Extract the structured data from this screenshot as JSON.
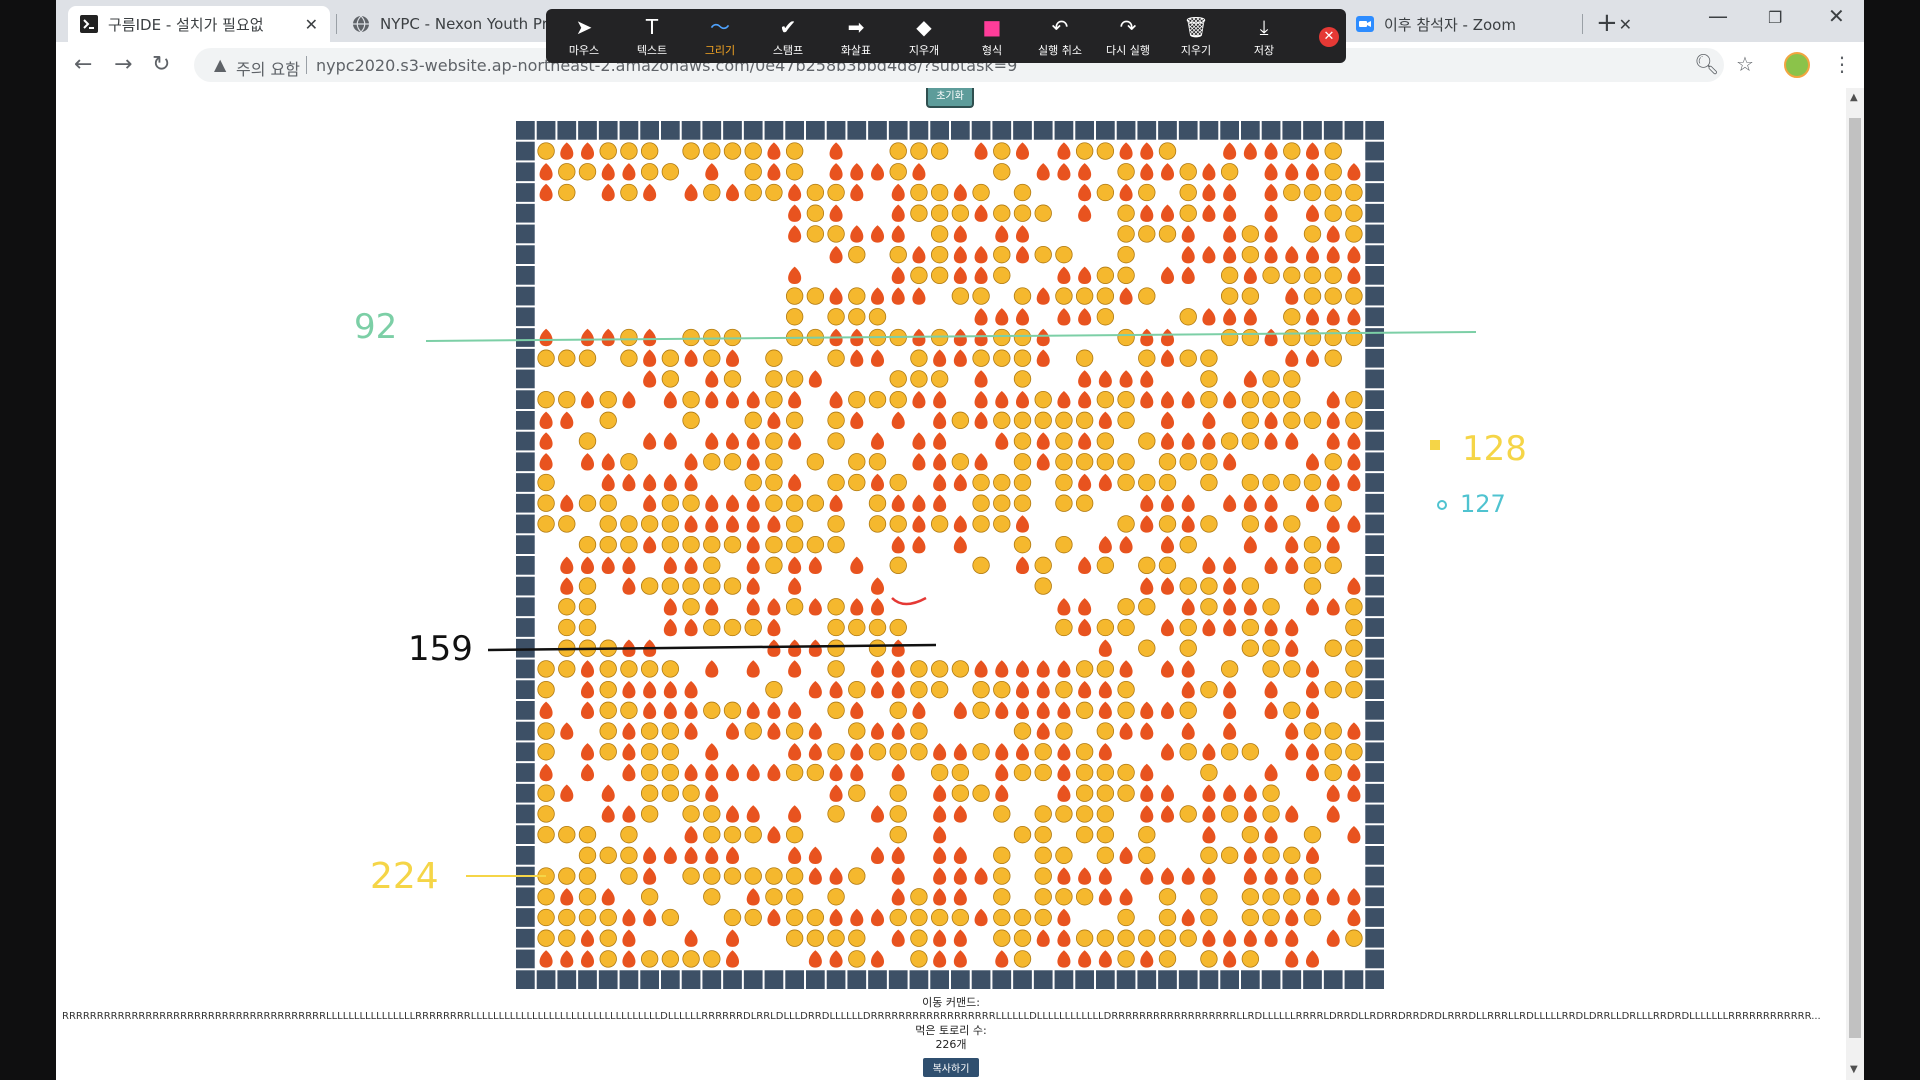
{
  "browser": {
    "tabs": [
      {
        "title": "구름IDE - 설치가 필요없",
        "icon": "terminal-icon"
      },
      {
        "title": "NYPC - Nexon Youth Pro",
        "icon": "globe-icon"
      },
      {
        "title": "이후 참석자 - Zoom",
        "icon": "zoom-icon"
      }
    ],
    "new_tab": "+",
    "security_warning": "주의 요함",
    "url": "nypc2020.s3-website.ap-northeast-2.amazonaws.com/0e47b258b3bbd4d8/?subtask=9"
  },
  "annotation_toolbar": {
    "tools": [
      {
        "label": "마우스",
        "icon": "mouse-pointer-icon",
        "glyph": "➤"
      },
      {
        "label": "텍스트",
        "icon": "text-icon",
        "glyph": "T"
      },
      {
        "label": "그리기",
        "icon": "draw-icon",
        "glyph": "〜",
        "selected": true
      },
      {
        "label": "스탬프",
        "icon": "stamp-icon",
        "glyph": "✔"
      },
      {
        "label": "화살표",
        "icon": "arrow-icon",
        "glyph": "➡"
      },
      {
        "label": "지우개",
        "icon": "eraser-icon",
        "glyph": "◆"
      },
      {
        "label": "형식",
        "icon": "format-icon",
        "glyph": "■",
        "color": "#ff3d9a"
      },
      {
        "label": "실행 취소",
        "icon": "undo-icon",
        "glyph": "↶"
      },
      {
        "label": "다시 실행",
        "icon": "redo-icon",
        "glyph": "↷"
      },
      {
        "label": "지우기",
        "icon": "trash-icon",
        "glyph": "🗑"
      },
      {
        "label": "저장",
        "icon": "save-icon",
        "glyph": "⤓"
      }
    ]
  },
  "page": {
    "reset_button": "초기화",
    "commands_label": "이동 커맨드:",
    "commands": "RRRRRRRRRRRRRRRRRRRRRRRRRRRRRRRRRRRRRRLLLLLLLLLLLLLLLLRRRRRRRRLLLLLLLLLLLLLLLLLLLLLLLLLLLLLLLLLLDLLLLLLRRRRRRDLRRLDLLLDRRDLLLLLLDRRRRRRRRRRRRRRRRRRLLLLLLDLLLLLLLLLLLLDRRRRRRRRRRRRRRRRRRLLRDLLLLLLRRRRLDRRDLLRDRRDRRDRDLRRRDLLRRRLLRDLLLLLRRDLDRRLLDRLLLRRDRDLLLLLLLRRRRRRRRRRRR...",
    "eaten_label": "먹은 토로리 수:",
    "eaten_count": "226개",
    "copy_button": "복사하기"
  },
  "annotations": {
    "left_92": "92",
    "left_159": "159",
    "left_224": "224",
    "right_128": "128",
    "right_127": "127",
    "colors": {
      "green": "#7ccfa6",
      "yellow": "#f5d547",
      "cyan": "#4fc3d0",
      "black": "#111111",
      "red": "#e53935"
    }
  },
  "board": {
    "wall_color": "#3d5066",
    "fire_color": "#e8531f",
    "face_color": "#f5b82e"
  }
}
